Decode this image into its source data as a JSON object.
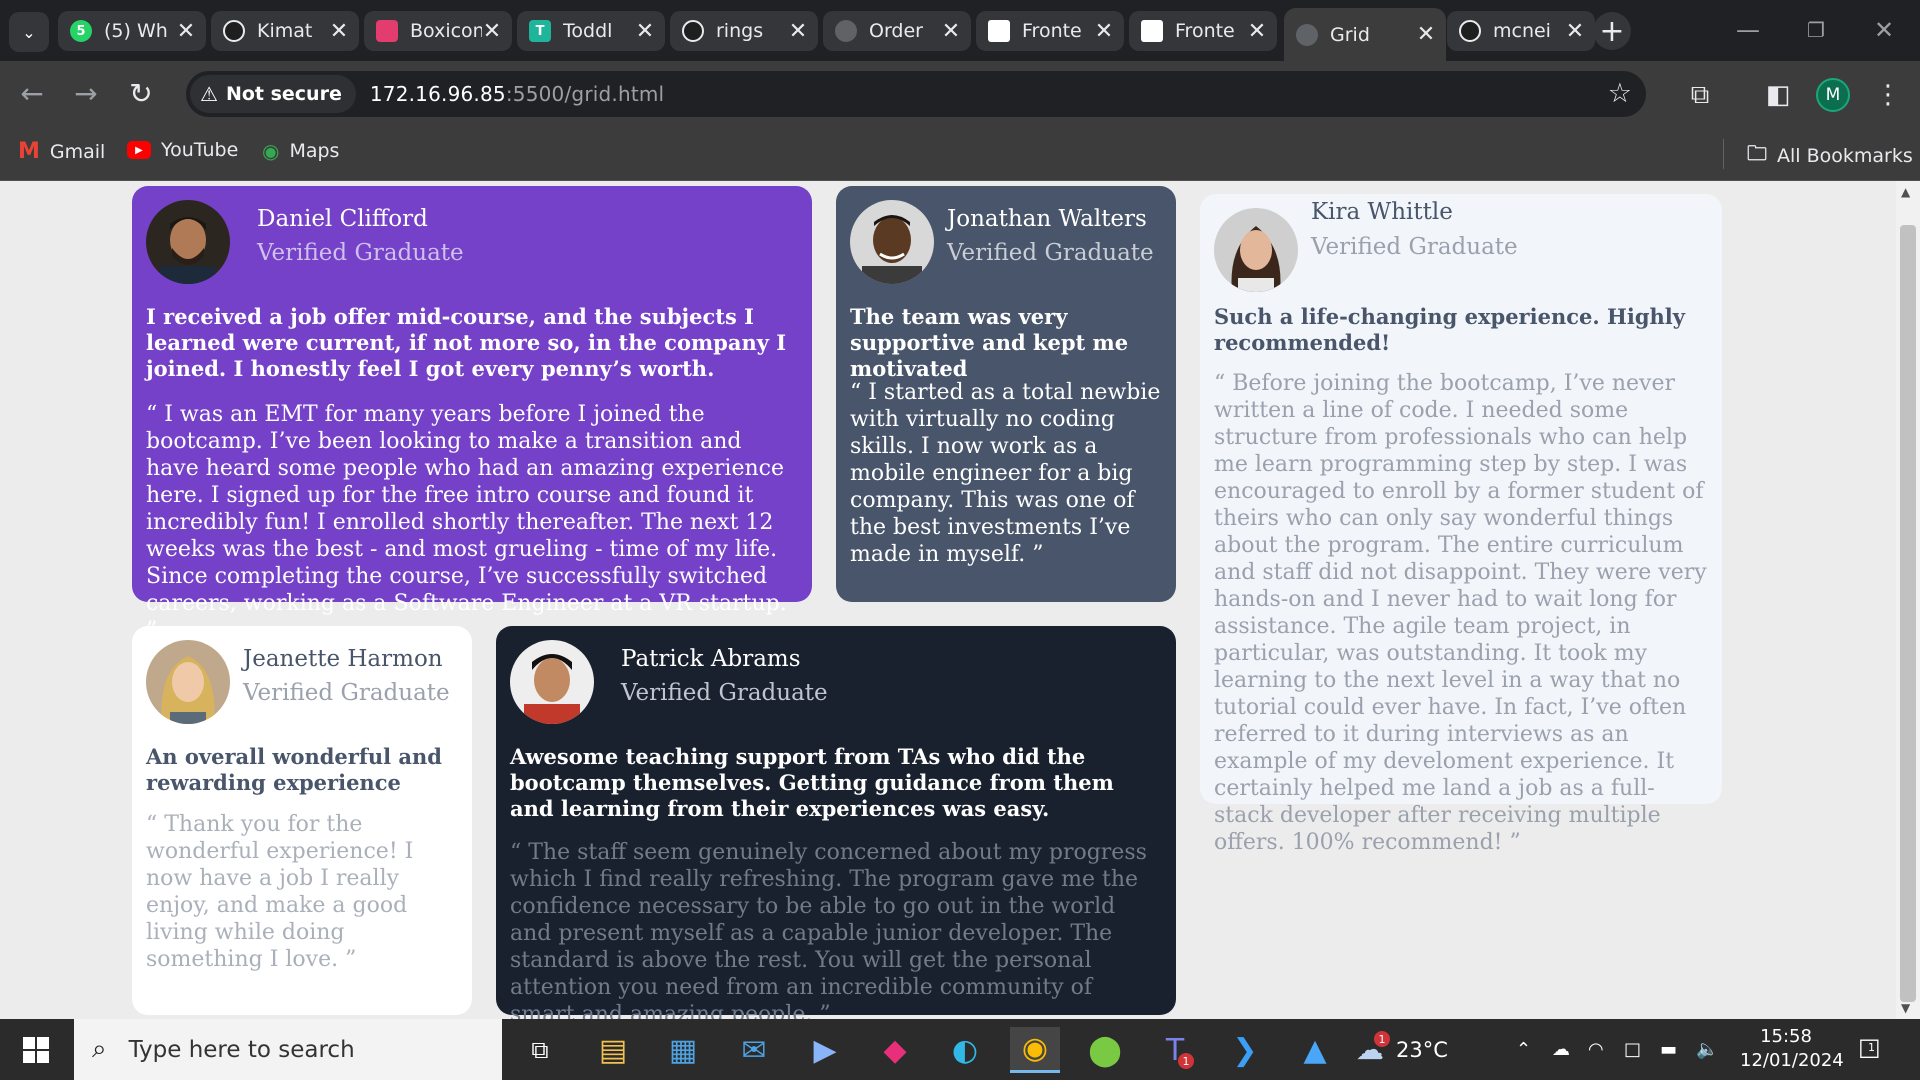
{
  "browser": {
    "tabs": [
      {
        "label": "(5) Wh",
        "icon": "whatsapp-icon",
        "color": "#25d366"
      },
      {
        "label": "Kimat",
        "icon": "chatgpt-icon",
        "color": "#1f1f1f"
      },
      {
        "label": "Boxicon",
        "icon": "boxicons-icon",
        "color": "#e33c6e"
      },
      {
        "label": "Toddl",
        "icon": "toddle-icon",
        "color": "#1fb59a"
      },
      {
        "label": "rings",
        "icon": "chatgpt-icon",
        "color": "#1f1f1f"
      },
      {
        "label": "Order",
        "icon": "globe-icon",
        "color": "#5f6368"
      },
      {
        "label": "Fronte",
        "icon": "frontend-mentor-icon",
        "color": "#ffffff"
      },
      {
        "label": "Fronte",
        "icon": "frontend-mentor-icon",
        "color": "#ffffff"
      },
      {
        "label": "Grid",
        "icon": "globe-icon",
        "color": "#5f6368",
        "active": true
      },
      {
        "label": "mcnei",
        "icon": "github-icon",
        "color": "#1f1f1f"
      }
    ],
    "security_label": "Not secure",
    "url_host": "172.16.96.85",
    "url_path": ":5500/grid.html",
    "profile_initial": "M",
    "bookmarks": [
      {
        "label": "Gmail",
        "icon": "gmail-icon"
      },
      {
        "label": "YouTube",
        "icon": "youtube-icon"
      },
      {
        "label": "Maps",
        "icon": "maps-icon"
      }
    ],
    "all_bookmarks_label": "All Bookmarks"
  },
  "testimonials": [
    {
      "name": "Daniel Clifford",
      "role": "Verified Graduate",
      "headline": "I received a job offer mid-course, and the subjects I learned were current, if not more so, in the company I joined. I honestly feel I got every penny’s worth.",
      "quote": "“ I was an EMT for many years before I joined the bootcamp. I’ve been looking to make a transition and have heard some people who had an amazing experience here. I signed up for the free intro course and found it incredibly fun! I enrolled shortly thereafter. The next 12 weeks was the best - and most grueling - time of my life. Since completing the course, I’ve successfully switched careers, working as a Software Engineer at a VR startup. ”",
      "bg": "#7541c8"
    },
    {
      "name": "Jonathan Walters",
      "role": "Verified Graduate",
      "headline": "The team was very supportive and kept me motivated",
      "quote": "“ I started as a total newbie with virtually no coding skills. I now work as a mobile engineer for a big company. This was one of the best investments I’ve made in myself. ”",
      "bg": "#48556a"
    },
    {
      "name": "Kira Whittle",
      "role": "Verified Graduate",
      "headline": "Such a life-changing experience. Highly recommended!",
      "quote": "“ Before joining the bootcamp, I’ve never written a line of code. I needed some structure from professionals who can help me learn programming step by step. I was encouraged to enroll by a former student of theirs who can only say wonderful things about the program. The entire curriculum and staff did not disappoint. They were very hands-on and I never had to wait long for assistance. The agile team project, in particular, was outstanding. It took my learning to the next level in a way that no tutorial could ever have. In fact, I’ve often referred to it during interviews as an example of my develoment experience. It certainly helped me land a job as a full-stack developer after receiving multiple offers. 100% recommend! ”",
      "bg": "#f2f5fa"
    },
    {
      "name": "Jeanette Harmon",
      "role": "Verified Graduate",
      "headline": "An overall wonderful and rewarding experience",
      "quote": "“ Thank you for the wonderful experience! I now have a job I really enjoy, and make a good living while doing something I love. ”",
      "bg": "#ffffff"
    },
    {
      "name": "Patrick Abrams",
      "role": "Verified Graduate",
      "headline": "Awesome teaching support from TAs who did the bootcamp themselves. Getting guidance from them and learning from their experiences was easy.",
      "quote": "“ The staff seem genuinely concerned about my progress which I find really refreshing. The program gave me the confidence necessary to be able to go out in the world and present myself as a capable junior developer. The standard is above the rest. You will get the personal attention you need from an incredible community of smart and amazing people. ”",
      "bg": "#19212e"
    }
  ],
  "taskbar": {
    "search_placeholder": "Type here to search",
    "weather": "23°C",
    "weather_badge": "1",
    "teams_badge": "1",
    "time": "15:58",
    "date": "12/01/2024",
    "notification_count": "1"
  }
}
